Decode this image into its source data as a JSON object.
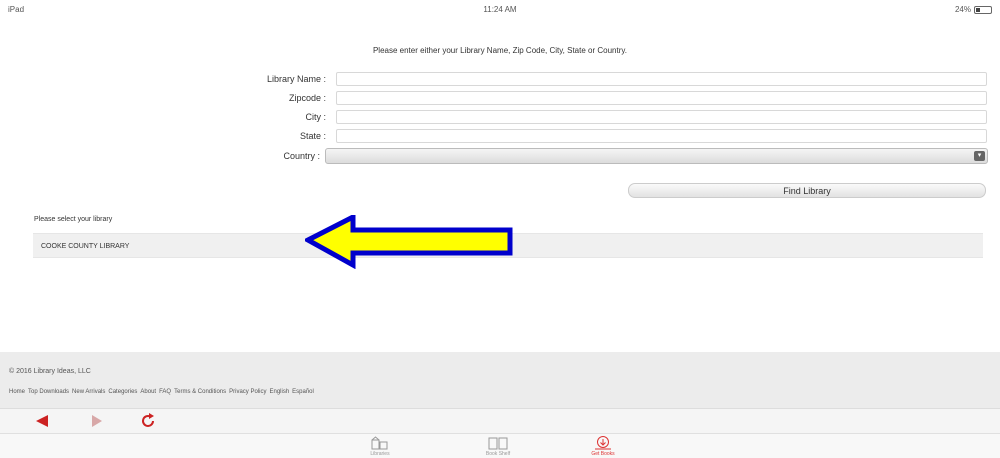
{
  "status_bar": {
    "device": "iPad",
    "time": "11:24 AM",
    "battery": "24%"
  },
  "prompt": "Please enter either your Library Name, Zip Code, City, State or Country.",
  "form": {
    "library_name_label": "Library Name :",
    "library_name_value": "",
    "zipcode_label": "Zipcode :",
    "zipcode_value": "",
    "city_label": "City :",
    "city_value": "",
    "state_label": "State :",
    "state_value": "",
    "country_label": "Country :",
    "country_value": "",
    "find_button": "Find Library"
  },
  "results": {
    "title": "Please select your library",
    "items": [
      "COOKE COUNTY LIBRARY"
    ]
  },
  "annotation_colors": {
    "arrow_fill": "#FFFF00",
    "arrow_stroke": "#0000CC"
  },
  "footer": {
    "copyright": "© 2016 Library Ideas, LLC",
    "links": [
      "Home",
      "Top Downloads",
      "New Arrivals",
      "Categories",
      "About",
      "FAQ",
      "Terms & Conditions",
      "Privacy Policy",
      "English",
      "Español"
    ]
  },
  "toolbar": {
    "back_icon": "back-arrow-icon",
    "forward_icon": "forward-arrow-icon",
    "refresh_icon": "refresh-icon"
  },
  "tabs": [
    {
      "label": "Libraries",
      "icon": "library-icon"
    },
    {
      "label": "Book Shelf",
      "icon": "bookshelf-icon"
    },
    {
      "label": "Get Books",
      "icon": "download-icon",
      "active": true
    }
  ],
  "colors": {
    "accent": "#D33333"
  }
}
